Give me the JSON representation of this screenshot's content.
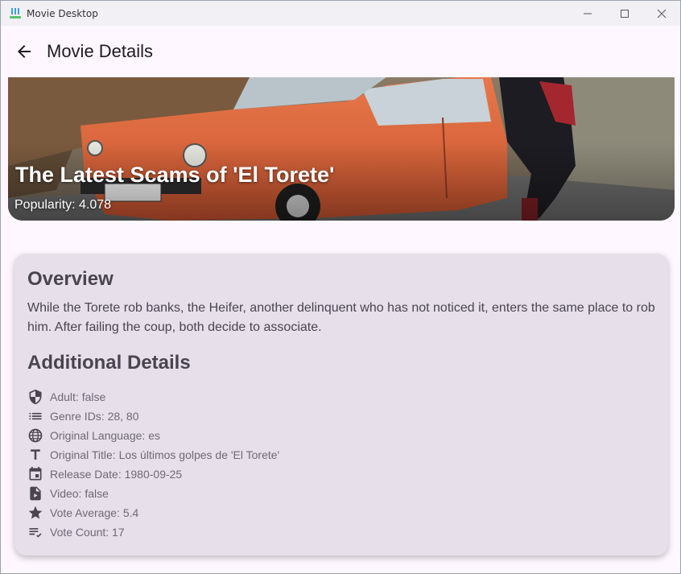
{
  "window": {
    "title": "Movie Desktop"
  },
  "appbar": {
    "title": "Movie Details"
  },
  "hero": {
    "title": "The Latest Scams of 'El Torete'",
    "popularity": "Popularity: 4.078"
  },
  "overview": {
    "heading": "Overview",
    "text": "While the Torete rob banks, the Heifer, another delinquent who has not noticed it, enters the same place to rob him. After failing the coup, both decide to associate."
  },
  "details": {
    "heading": "Additional Details",
    "items": [
      {
        "icon": "shield-icon",
        "text": "Adult: false"
      },
      {
        "icon": "list-icon",
        "text": "Genre IDs: 28, 80"
      },
      {
        "icon": "globe-icon",
        "text": "Original Language: es"
      },
      {
        "icon": "title-icon",
        "text": "Original Title: Los últimos golpes de 'El Torete'"
      },
      {
        "icon": "calendar-icon",
        "text": "Release Date: 1980-09-25"
      },
      {
        "icon": "video-file-icon",
        "text": "Video: false"
      },
      {
        "icon": "star-icon",
        "text": "Vote Average: 5.4"
      },
      {
        "icon": "checklist-icon",
        "text": "Vote Count: 17"
      }
    ]
  }
}
